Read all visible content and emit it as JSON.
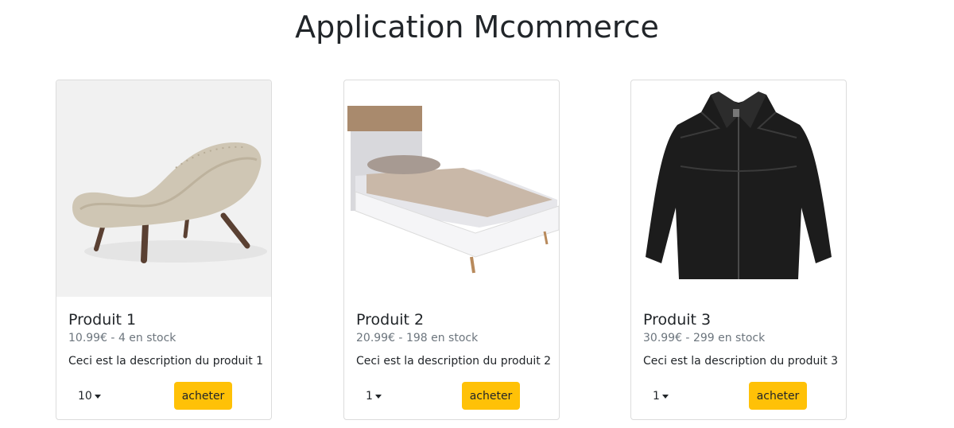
{
  "app": {
    "title": "Application Mcommerce"
  },
  "products": [
    {
      "name": "Produit 1",
      "stock_line": "10.99€ - 4 en stock",
      "description": "Ceci est la description du produit 1",
      "quantity": "10",
      "buy_label": "acheter",
      "image_icon": "chaise-longue-image"
    },
    {
      "name": "Produit 2",
      "stock_line": "20.99€ - 198 en stock",
      "description": "Ceci est la description du produit 2",
      "quantity": "1",
      "buy_label": "acheter",
      "image_icon": "bed-image"
    },
    {
      "name": "Produit 3",
      "stock_line": "30.99€ - 299 en stock",
      "description": "Ceci est la description du produit 3",
      "quantity": "1",
      "buy_label": "acheter",
      "image_icon": "leather-jacket-image"
    }
  ],
  "colors": {
    "button": "#ffc107",
    "card_border": "#dcdcdc",
    "muted_text": "#6c757d"
  }
}
